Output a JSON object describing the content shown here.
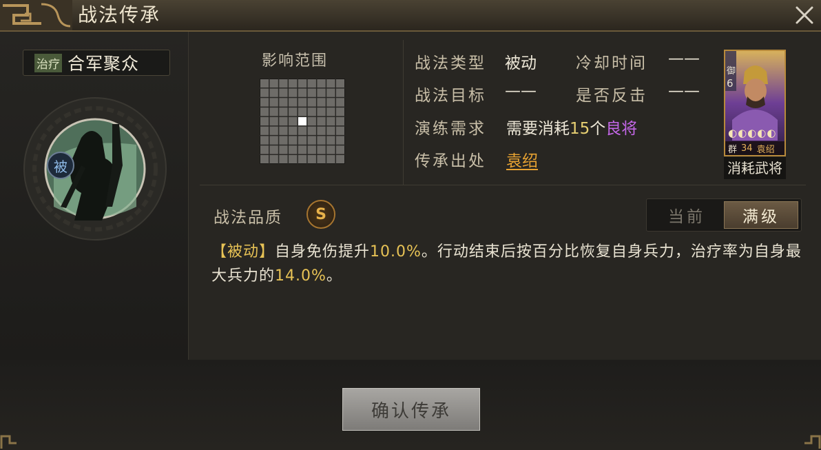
{
  "window": {
    "title": "战法传承"
  },
  "skill": {
    "tag": "治疗",
    "name": "合军聚众",
    "passive_badge": "被"
  },
  "range": {
    "label": "影响范围"
  },
  "info": {
    "type_label": "战法类型",
    "type_value": "被动",
    "cooldown_label": "冷却时间",
    "cooldown_value": "——",
    "target_label": "战法目标",
    "target_value": "——",
    "counter_label": "是否反击",
    "counter_value": "——",
    "train_label": "演练需求",
    "train_prefix": "需要消耗",
    "train_count": "15",
    "train_unit": "个",
    "train_item": "良将",
    "origin_label": "传承出处",
    "origin_value": "袁绍"
  },
  "hero": {
    "troop": "御",
    "cost": "6",
    "faction": "群",
    "level": "34",
    "name": "袁绍",
    "consume_label": "消耗武将"
  },
  "quality": {
    "label": "战法品质",
    "grade": "S"
  },
  "toggle": {
    "current": "当前",
    "max": "满级"
  },
  "description": {
    "tag": "【被动】",
    "p1": "自身免伤提升",
    "v1": "10.0%",
    "p2": "。行动结束后按百分比恢复自身兵力，治疗率为自身最大兵力的",
    "v2": "14.0%",
    "p3": "。"
  },
  "confirm": {
    "label": "确认传承"
  }
}
